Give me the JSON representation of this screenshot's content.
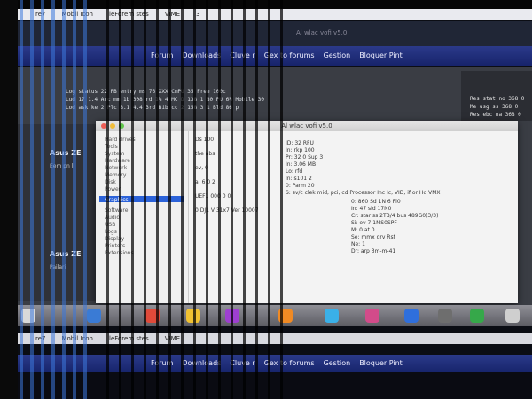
{
  "scene": {
    "description_kind": "photo",
    "colors": {
      "menubar": "#e9eaef",
      "tabbar": "#1f2d7a",
      "terminal_bg": "#3a3d44",
      "dialog_bg": "#f3f3f3",
      "selection": "#2b62d9",
      "dock": "#76767d"
    }
  },
  "menubar": {
    "items": [
      "re7",
      "Mobil Icon",
      "leForem stes",
      "VIME",
      "3"
    ]
  },
  "tabbar": {
    "items": [
      "Forum",
      "Downloads",
      "Cluve r",
      "Gex to forums",
      "Gestion",
      "Bloquer Pint"
    ]
  },
  "window_title": "Al wlac vofi v5.0",
  "left_panel": {
    "heading1": "Asus ZE",
    "line1": "Eem pn ll",
    "heading2": "Asus ZE",
    "line2": "Pailari"
  },
  "right_widget": {
    "rows": [
      "Res stat no 368 0",
      "Me usg ss 368 0",
      "Res ebc na 368 0"
    ]
  },
  "terminal": {
    "lines": [
      "Log status 22 PB entry ms 76 XXX CmPU 35 Free 100c",
      "Lud 17 1.4 Arc mm 1b 308 rd 1% 4 MC D 138 1 80 PU 6% Mobile 30",
      "Lod ask ke 2 Plc 8.1 4.4 3rd Bib cc 2 158 3 1 Bld 86 p"
    ]
  },
  "dialog": {
    "title": "Al wlac vofi v5.0",
    "side_items": [
      "Hard drives",
      "Tools",
      "System",
      "Hardware",
      "Network",
      "Memory",
      "Disk",
      "Power",
      "Graphics",
      "Software",
      "Audio",
      "USB",
      "Logs",
      "Display",
      "Printers",
      "Extensions"
    ],
    "content_rows": [
      "ID: 32 RFU",
      "In: rkp 100",
      "Pr: 32 0 Sup 3",
      "In: 3.06 MB",
      "Lo: rfd",
      "In: s101 2",
      "0: Parm 20",
      "S: sv/c clek mid, pci, cd Processor Inc Ic, VID, if or Hd VMX",
      "0: 860 Sd 1N 6 Pl0",
      "In: 47 sid 17N0",
      "Cr: star ss 2TB/4 bus 489G0(3/3)",
      "Si: ev 7 1MS0SPF",
      "M: 0 at 0",
      "Se: mmx drv Rst",
      "Ne: 1",
      "Dr: arp 3m-m-41"
    ],
    "left_rows": [
      "Ds 100",
      "the abs",
      "ev, 0",
      "a: 6 0 2",
      "UEF1 000 0 0",
      "0 DJ1 V 31x7 Ver 10007"
    ]
  }
}
